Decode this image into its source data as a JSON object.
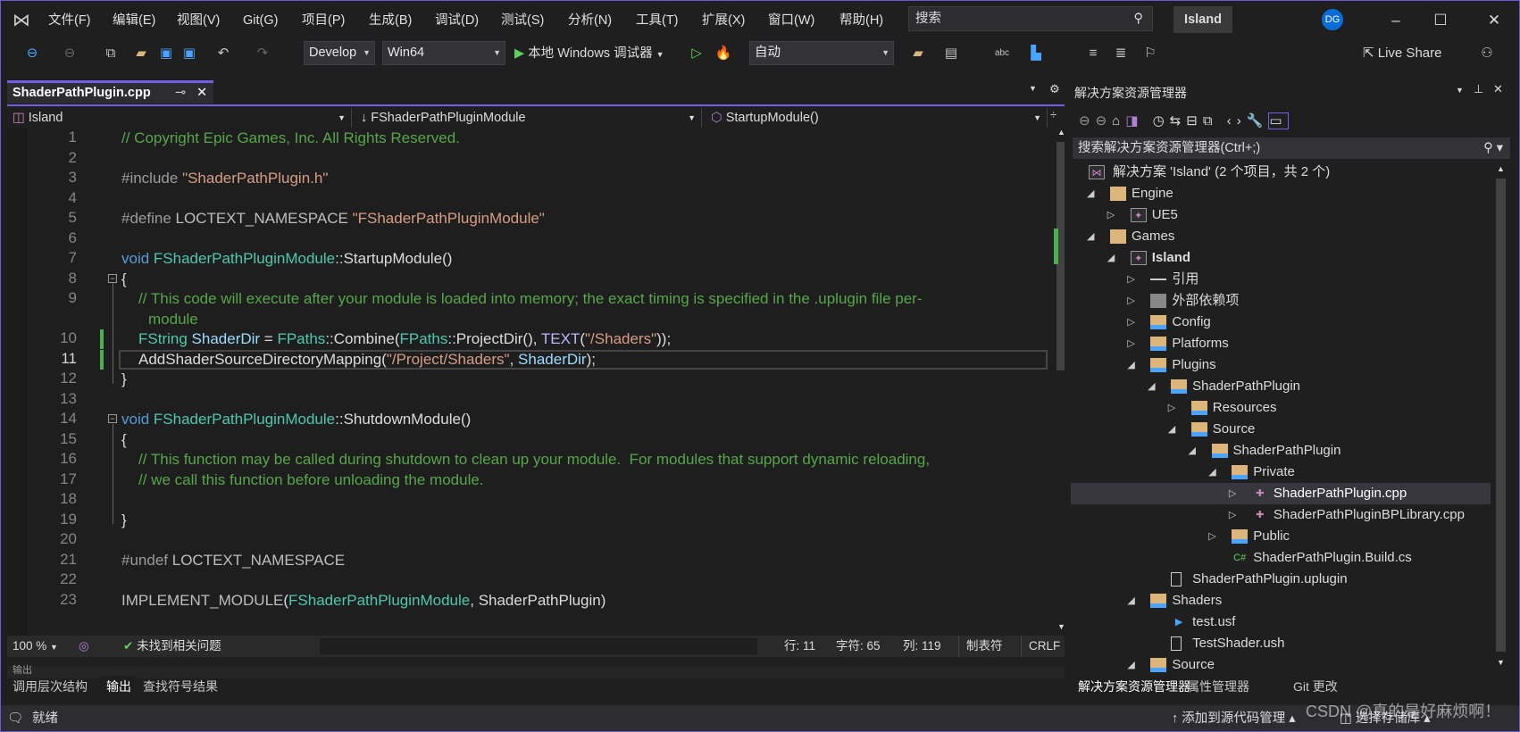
{
  "menu": [
    "文件(F)",
    "编辑(E)",
    "视图(V)",
    "Git(G)",
    "项目(P)",
    "生成(B)",
    "调试(D)",
    "测试(S)",
    "分析(N)",
    "工具(T)",
    "扩展(X)",
    "窗口(W)",
    "帮助(H)"
  ],
  "search": {
    "placeholder": "搜索"
  },
  "solution_name": "Island",
  "avatar": "DG",
  "toolbar": {
    "config": "Develop",
    "platform": "Win64",
    "run_label": "本地 Windows 调试器",
    "auto": "自动",
    "live_share": "Live Share"
  },
  "doc_tab": {
    "label": "ShaderPathPlugin.cpp"
  },
  "nav": {
    "project": "Island",
    "scope": "FShaderPathPluginModule",
    "member": "StartupModule()"
  },
  "code": {
    "rows": [
      {
        "n": "1",
        "t": [
          [
            "// Copyright Epic Games, Inc. All Rights Reserved.",
            "cm"
          ]
        ]
      },
      {
        "n": "2",
        "t": []
      },
      {
        "n": "3",
        "t": [
          [
            "#include ",
            "pp"
          ],
          [
            "\"ShaderPathPlugin.h\"",
            "st"
          ]
        ]
      },
      {
        "n": "4",
        "t": []
      },
      {
        "n": "5",
        "t": [
          [
            "#define ",
            "pp"
          ],
          [
            "LOCTEXT_NAMESPACE ",
            "mc"
          ],
          [
            "\"FShaderPathPluginModule\"",
            "st"
          ]
        ]
      },
      {
        "n": "6",
        "t": []
      },
      {
        "n": "7",
        "t": [
          [
            "void ",
            "kw"
          ],
          [
            "FShaderPathPluginModule",
            "ty"
          ],
          [
            "::",
            "pl"
          ],
          [
            "StartupModule",
            "fn"
          ],
          [
            "()",
            "pl"
          ]
        ]
      },
      {
        "n": "8",
        "t": [
          [
            "{",
            "pl"
          ]
        ]
      },
      {
        "n": "9",
        "i": 1,
        "t": [
          [
            "// This code will execute after your module is loaded into memory; the exact timing is specified in the .uplugin file per-",
            "cm"
          ]
        ]
      },
      {
        "n": "",
        "i": 2,
        "t": [
          [
            "module",
            "cm"
          ]
        ]
      },
      {
        "n": "10",
        "i": 1,
        "t": [
          [
            "FString ",
            "ty"
          ],
          [
            "ShaderDir",
            "va"
          ],
          [
            " = ",
            "pl"
          ],
          [
            "FPaths",
            "ty"
          ],
          [
            "::",
            "pl"
          ],
          [
            "Combine",
            "fn"
          ],
          [
            "(",
            "pl"
          ],
          [
            "FPaths",
            "ty"
          ],
          [
            "::",
            "pl"
          ],
          [
            "ProjectDir",
            "fn"
          ],
          [
            "(), ",
            "pl"
          ],
          [
            "TEXT",
            "tx"
          ],
          [
            "(",
            "pl"
          ],
          [
            "\"/Shaders\"",
            "st"
          ],
          [
            "));",
            "pl"
          ]
        ]
      },
      {
        "n": "11",
        "i": 1,
        "t": [
          [
            "AddShaderSourceDirectoryMapping",
            "fn"
          ],
          [
            "(",
            "pl"
          ],
          [
            "\"/Project/Shaders\"",
            "st"
          ],
          [
            ", ",
            "pl"
          ],
          [
            "ShaderDir",
            "va"
          ],
          [
            ");",
            "pl"
          ]
        ]
      },
      {
        "n": "12",
        "t": [
          [
            "}",
            "pl"
          ]
        ]
      },
      {
        "n": "13",
        "t": []
      },
      {
        "n": "14",
        "t": [
          [
            "void ",
            "kw"
          ],
          [
            "FShaderPathPluginModule",
            "ty"
          ],
          [
            "::",
            "pl"
          ],
          [
            "ShutdownModule",
            "fn"
          ],
          [
            "()",
            "pl"
          ]
        ]
      },
      {
        "n": "15",
        "t": [
          [
            "{",
            "pl"
          ]
        ]
      },
      {
        "n": "16",
        "i": 1,
        "t": [
          [
            "// This function may be called during shutdown to clean up your module.  For modules that support dynamic reloading,",
            "cm"
          ]
        ]
      },
      {
        "n": "17",
        "i": 1,
        "t": [
          [
            "// we call this function before unloading the module.",
            "cm"
          ]
        ]
      },
      {
        "n": "18",
        "t": []
      },
      {
        "n": "19",
        "t": [
          [
            "}",
            "pl"
          ]
        ]
      },
      {
        "n": "20",
        "t": []
      },
      {
        "n": "21",
        "t": [
          [
            "#undef ",
            "pp"
          ],
          [
            "LOCTEXT_NAMESPACE",
            "mc"
          ]
        ]
      },
      {
        "n": "22",
        "t": []
      },
      {
        "n": "23",
        "t": [
          [
            "IMPLEMENT_MODULE",
            "mc"
          ],
          [
            "(",
            "pl"
          ],
          [
            "FShaderPathPluginModule",
            "ty"
          ],
          [
            ", ",
            "pl"
          ],
          [
            "ShaderPathPlugin",
            "pl"
          ],
          [
            ")",
            "pl"
          ]
        ]
      }
    ],
    "current_line": "11"
  },
  "editor_status": {
    "zoom": "100 %",
    "issues": "未找到相关问题",
    "line": "行: 11",
    "char": "字符: 65",
    "col": "列: 119",
    "tabs": "制表符",
    "eol": "CRLF"
  },
  "output": {
    "title": "输出"
  },
  "bottom_tabs": [
    "调用层次结构",
    "输出",
    "查找符号结果"
  ],
  "statusbar": {
    "ready": "就绪",
    "add_source": "添加到源代码管理",
    "select_repo": "选择存储库",
    "watermark": "CSDN @真的是好麻烦啊！"
  },
  "solution_explorer": {
    "title": "解决方案资源管理器",
    "search_placeholder": "搜索解决方案资源管理器(Ctrl+;)",
    "tree": [
      {
        "l": -1,
        "e": "none",
        "icon": "solution",
        "label": "解决方案 'Island' (2 个项目，共 2 个)"
      },
      {
        "l": 0,
        "e": "open",
        "icon": "folder",
        "label": "Engine"
      },
      {
        "l": 1,
        "e": "closed",
        "icon": "project",
        "label": "UE5"
      },
      {
        "l": 0,
        "e": "open",
        "icon": "folder",
        "label": "Games"
      },
      {
        "l": 1,
        "e": "open",
        "icon": "project",
        "label": "Island",
        "bold": true
      },
      {
        "l": 2,
        "e": "closed",
        "icon": "references",
        "label": "引用"
      },
      {
        "l": 2,
        "e": "closed",
        "icon": "external-deps",
        "label": "外部依赖项"
      },
      {
        "l": 2,
        "e": "closed",
        "icon": "filter-folder",
        "label": "Config"
      },
      {
        "l": 2,
        "e": "closed",
        "icon": "filter-folder",
        "label": "Platforms"
      },
      {
        "l": 2,
        "e": "open",
        "icon": "filter-folder",
        "label": "Plugins"
      },
      {
        "l": 3,
        "e": "open",
        "icon": "filter-folder",
        "label": "ShaderPathPlugin"
      },
      {
        "l": 4,
        "e": "closed",
        "icon": "filter-folder",
        "label": "Resources"
      },
      {
        "l": 4,
        "e": "open",
        "icon": "filter-folder",
        "label": "Source"
      },
      {
        "l": 5,
        "e": "open",
        "icon": "filter-folder",
        "label": "ShaderPathPlugin"
      },
      {
        "l": 6,
        "e": "open",
        "icon": "filter-folder",
        "label": "Private"
      },
      {
        "l": 7,
        "e": "closed",
        "icon": "cpp-file",
        "label": "ShaderPathPlugin.cpp",
        "selected": true
      },
      {
        "l": 7,
        "e": "closed",
        "icon": "cpp-file",
        "label": "ShaderPathPluginBPLibrary.cpp"
      },
      {
        "l": 6,
        "e": "closed",
        "icon": "filter-folder",
        "label": "Public"
      },
      {
        "l": 6,
        "e": "none",
        "icon": "csharp-file",
        "label": "ShaderPathPlugin.Build.cs"
      },
      {
        "l": 3,
        "e": "none",
        "icon": "file",
        "label": "ShaderPathPlugin.uplugin"
      },
      {
        "l": 2,
        "e": "open",
        "icon": "filter-folder",
        "label": "Shaders"
      },
      {
        "l": 3,
        "e": "none",
        "icon": "usf-file",
        "label": "test.usf"
      },
      {
        "l": 3,
        "e": "none",
        "icon": "file",
        "label": "TestShader.ush"
      },
      {
        "l": 2,
        "e": "open",
        "icon": "filter-folder",
        "label": "Source"
      }
    ],
    "tabs": [
      "解决方案资源管理器",
      "属性管理器",
      "Git 更改"
    ]
  },
  "colors": {
    "accent": "#7160e8",
    "comment": "#57a64a",
    "string": "#d69d85",
    "keyword": "#569cd6",
    "type": "#4ec9b0",
    "change_marker": "#4caf50"
  }
}
